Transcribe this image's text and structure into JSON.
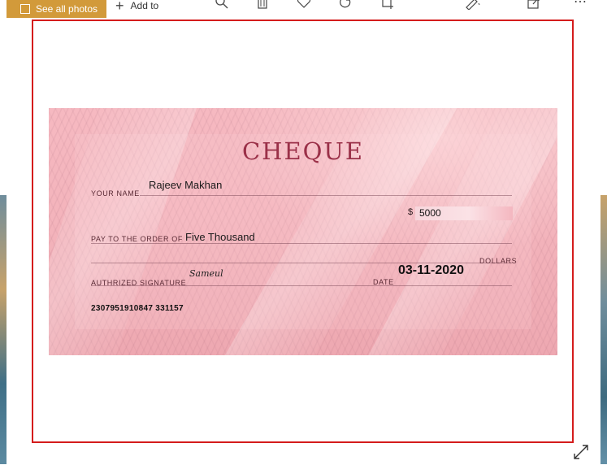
{
  "toolbar": {
    "see_all_label": "See all photos",
    "add_to_label": "Add to",
    "more_label": "⋯"
  },
  "cheque": {
    "title": "CHEQUE",
    "your_name_label": "YOUR NAME",
    "your_name_value": "Rajeev Makhan",
    "dollar_sign": "$",
    "amount_value": "5000",
    "pay_to_label": "PAY TO THE ORDER OF",
    "pay_to_value": "Five Thousand",
    "dollars_label": "DOLLARS",
    "signature_label": "AUTHRIZED SIGNATURE",
    "signature_value": "Sameul",
    "date_label": "DATE",
    "date_value": "03-11-2020",
    "micr_line": "2307951910847  331157"
  },
  "colors": {
    "accent": "#d29a3a",
    "frame_border": "#d41c1c",
    "cheque_bg": "#f3b3bb",
    "title_color": "#9a3048"
  },
  "icons": [
    "photos-icon",
    "plus-icon",
    "zoom-icon",
    "delete-icon",
    "favorite-icon",
    "rotate-icon",
    "crop-icon",
    "edit-icon",
    "share-icon",
    "more-icon",
    "expand-icon"
  ]
}
